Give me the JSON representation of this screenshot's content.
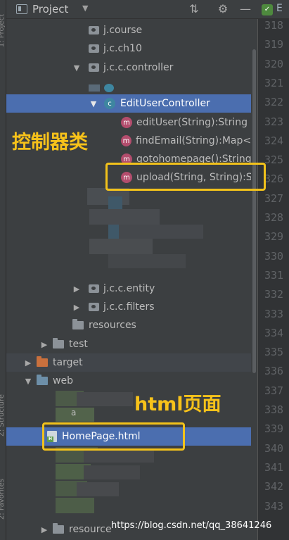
{
  "tool_window": {
    "title": "Project",
    "side_labels": [
      "1: Project",
      "Z: Structure",
      "2: Favorites"
    ],
    "editor_tab_label": "E"
  },
  "tree": {
    "pkg_course": "j.course",
    "pkg_ch10": "j.c.ch10",
    "pkg_controller": "j.c.c.controller",
    "class_name": "EditUserController",
    "methods": [
      "editUser(String):String",
      "findEmail(String):Map<S",
      "gotohomepage():String",
      "upload(String, String):St"
    ],
    "pkg_entity": "j.c.c.entity",
    "pkg_filters": "j.c.c.filters",
    "resources": "resources",
    "test": "test",
    "target": "target",
    "web": "web",
    "web_partial_label": "a",
    "html_file": "HomePage.html",
    "resource_partial": "resource"
  },
  "annotations": {
    "controller_label": "控制器类",
    "html_label": "html页面"
  },
  "line_numbers": [
    "318",
    "319",
    "320",
    "321",
    "322",
    "323",
    "324",
    "325",
    "326",
    "327",
    "328",
    "329",
    "330",
    "331",
    "332",
    "333",
    "334",
    "335",
    "336",
    "337",
    "338",
    "339",
    "340",
    "341",
    "342",
    "343"
  ],
  "watermark": "https://blog.csdn.net/qq_38641246",
  "colors": {
    "background": "#3c3f41",
    "selection": "#4b6eaf",
    "annotation": "#f2c21b",
    "method_icon": "#b34d6d",
    "class_icon": "#3e86a0"
  }
}
